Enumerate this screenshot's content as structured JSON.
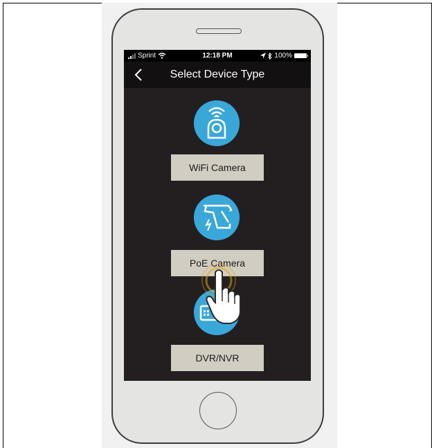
{
  "status_bar": {
    "carrier": "Sprint",
    "time": "12:18 PM",
    "battery": "100%"
  },
  "nav": {
    "title": "Select Device Type"
  },
  "devices": [
    {
      "label": "WiFi Camera",
      "icon": "wifi-camera-icon"
    },
    {
      "label": "PoE Camera",
      "icon": "cctv-camera-icon"
    },
    {
      "label": "DVR/NVR",
      "icon": "dvr-recorder-icon"
    }
  ],
  "colors": {
    "screen_bg": "#231f20",
    "icon_circle": "#3aa7d9",
    "button_bg": "#d2cdc2",
    "touch_ripple": "#e0a51c"
  }
}
